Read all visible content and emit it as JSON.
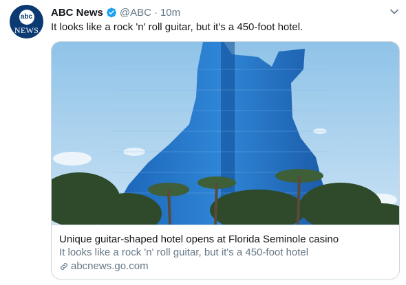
{
  "tweet": {
    "avatar": {
      "logo_text": "abc",
      "sub_text": "NEWS"
    },
    "display_name": "ABC News",
    "verified": true,
    "handle": "@ABC",
    "separator": "·",
    "timestamp": "10m",
    "text": "It looks like a rock 'n' roll guitar, but it's a 450-foot hotel.",
    "menu_icon": "chevron-down-icon"
  },
  "card": {
    "image_description_icon": "guitar-hotel-photo",
    "title": "Unique guitar-shaped hotel opens at Florida Seminole casino",
    "description": "It looks like a rock 'n' roll guitar, but it's a 450-foot hotel",
    "domain": "abcnews.go.com",
    "domain_icon": "link-icon"
  },
  "colors": {
    "text_primary": "#14171a",
    "text_secondary": "#657786",
    "verified_blue": "#1da1f2",
    "border": "#ccd6dd",
    "avatar_bg": "#0b3a73"
  }
}
